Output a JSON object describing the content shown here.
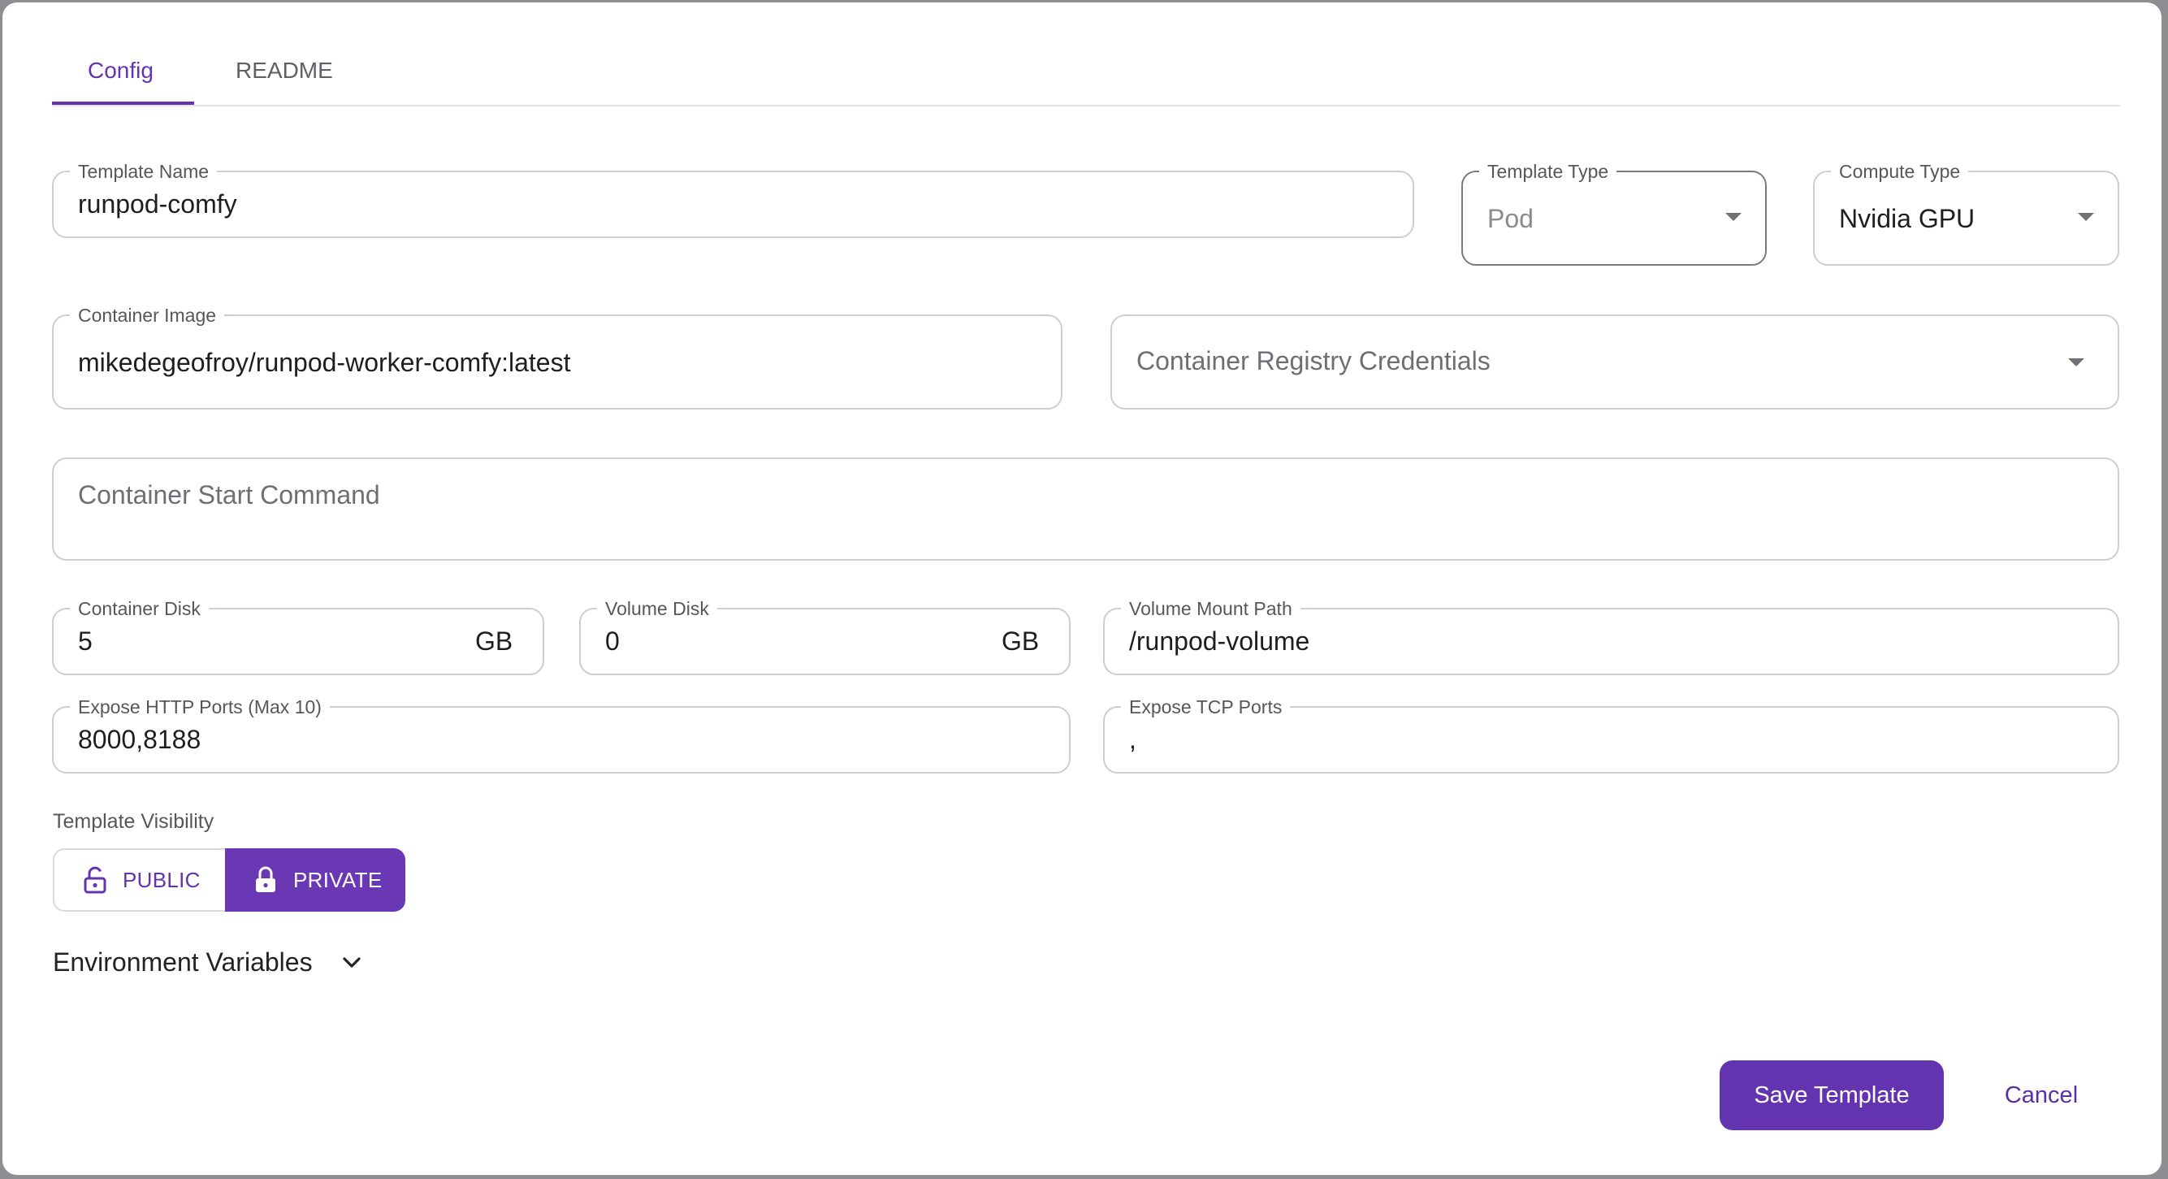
{
  "tabs": [
    {
      "label": "Config",
      "active": true
    },
    {
      "label": "README",
      "active": false
    }
  ],
  "fields": {
    "template_name": {
      "label": "Template Name",
      "value": "runpod-comfy"
    },
    "template_type": {
      "label": "Template Type",
      "value": "Pod"
    },
    "compute_type": {
      "label": "Compute Type",
      "value": "Nvidia GPU"
    },
    "container_image": {
      "label": "Container Image",
      "value": "mikedegeofroy/runpod-worker-comfy:latest"
    },
    "registry_credentials": {
      "placeholder": "Container Registry Credentials"
    },
    "start_command": {
      "placeholder": "Container Start Command"
    },
    "container_disk": {
      "label": "Container Disk",
      "value": "5",
      "unit": "GB"
    },
    "volume_disk": {
      "label": "Volume Disk",
      "value": "0",
      "unit": "GB"
    },
    "volume_mount_path": {
      "label": "Volume Mount Path",
      "value": "/runpod-volume"
    },
    "http_ports": {
      "label": "Expose HTTP Ports (Max 10)",
      "value": "8000,8188"
    },
    "tcp_ports": {
      "label": "Expose TCP Ports",
      "value": ","
    }
  },
  "visibility": {
    "label": "Template Visibility",
    "options": [
      {
        "label": "PUBLIC",
        "icon": "lock-open-icon",
        "selected": false
      },
      {
        "label": "PRIVATE",
        "icon": "lock-icon",
        "selected": true
      }
    ]
  },
  "env_vars": {
    "label": "Environment Variables",
    "icon": "chevron-down-icon"
  },
  "actions": {
    "save_label": "Save Template",
    "cancel_label": "Cancel"
  },
  "colors": {
    "accent": "#6434b0",
    "border": "#cdcdd3",
    "backdrop": "#8e8e92"
  }
}
